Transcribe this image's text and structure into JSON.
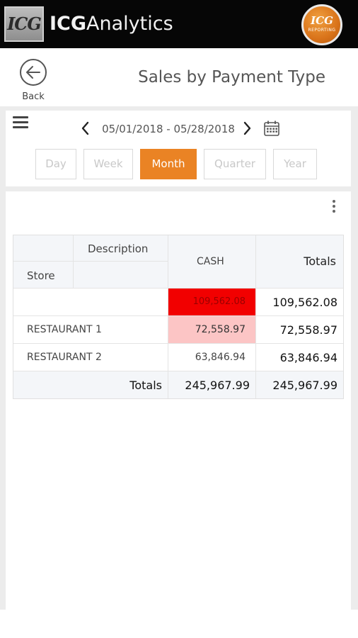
{
  "app": {
    "logo_text": "ICG",
    "brand_bold": "ICG",
    "brand_rest": "Analytics",
    "avatar_top": "ICG",
    "avatar_bottom": "REPORTING"
  },
  "header": {
    "back_label": "Back",
    "title": "Sales by Payment Type"
  },
  "filters": {
    "date_range": "05/01/2018 - 05/28/2018",
    "periods": [
      "Day",
      "Week",
      "Month",
      "Quarter",
      "Year"
    ],
    "active_period": "Month"
  },
  "table": {
    "header_description": "Description",
    "header_store": "Store",
    "columns": [
      "CASH",
      "Totals"
    ],
    "rows": [
      {
        "store": "",
        "cash": "109,562.08",
        "total": "109,562.08",
        "cash_color": "#f20000",
        "cash_text_color": "#9a0000"
      },
      {
        "store": "RESTAURANT 1",
        "cash": "72,558.97",
        "total": "72,558.97",
        "cash_color": "#fcc5c5",
        "cash_text_color": "#444444"
      },
      {
        "store": "RESTAURANT 2",
        "cash": "63,846.94",
        "total": "63,846.94",
        "cash_color": "#ffffff",
        "cash_text_color": "#444444"
      }
    ],
    "totals_label": "Totals",
    "totals_cash": "245,967.99",
    "totals_total": "245,967.99"
  },
  "colors": {
    "accent": "#ea8324",
    "topbar": "#060606"
  },
  "icons": {
    "back": "back-arrow-icon",
    "menu": "hamburger-menu-icon",
    "prev": "chevron-left-icon",
    "next": "chevron-right-icon",
    "calendar": "calendar-icon",
    "more": "more-vertical-icon"
  }
}
